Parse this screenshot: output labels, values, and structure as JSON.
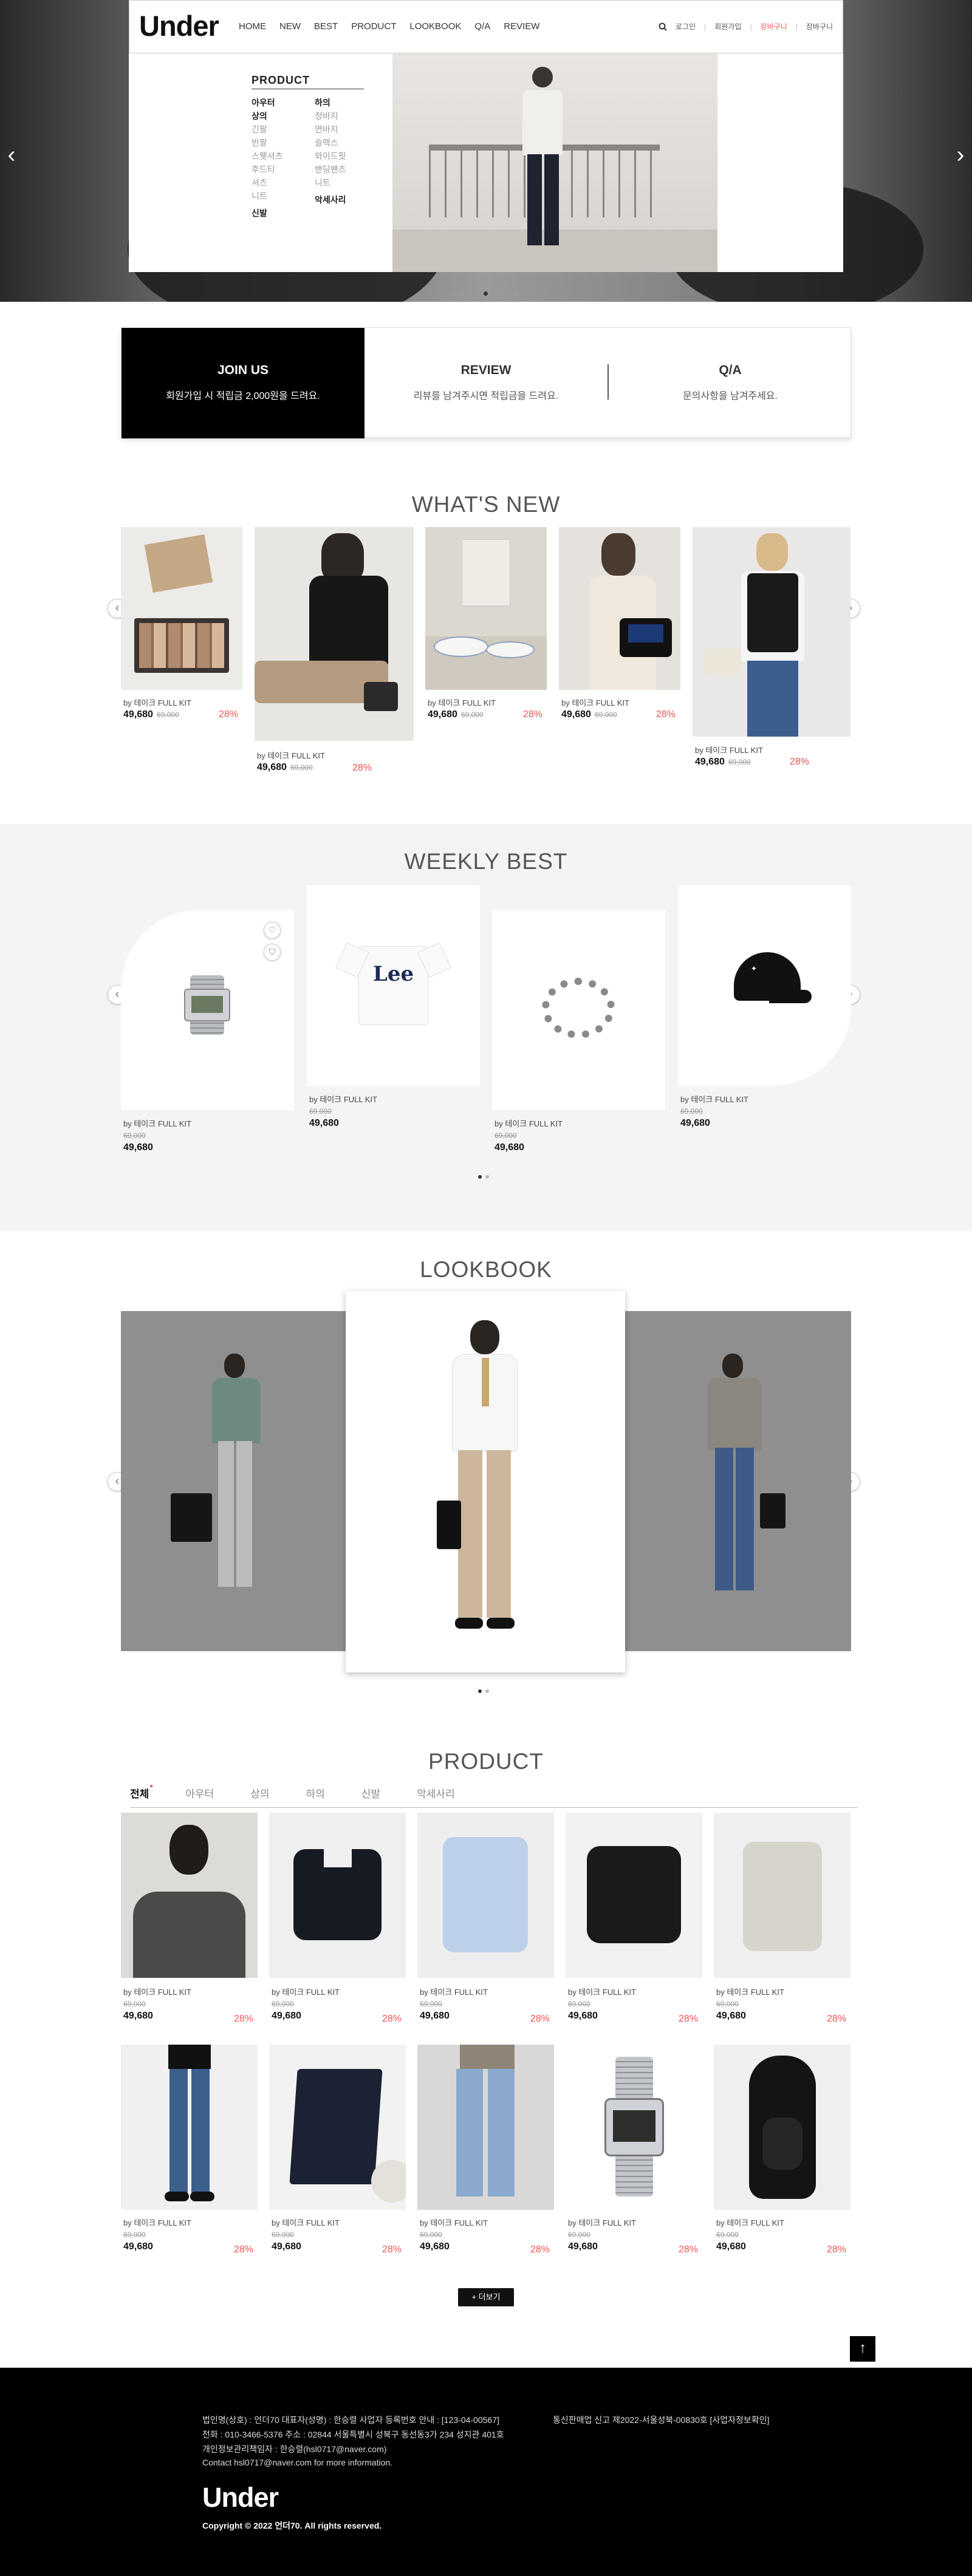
{
  "header": {
    "logo": "Under",
    "nav": [
      "HOME",
      "NEW",
      "BEST",
      "PRODUCT",
      "LOOKBOOK",
      "Q/A",
      "REVIEW"
    ],
    "util": {
      "login": "로그인",
      "join": "회원가입",
      "mypage": "장바구니",
      "cart": "장바구니"
    }
  },
  "dropdown": {
    "title": "PRODUCT",
    "col1": {
      "heads": [
        "아우터",
        "상의",
        "신발"
      ],
      "items": [
        "긴팔",
        "반팔",
        "스웻셔츠",
        "후드티",
        "셔츠",
        "니트"
      ]
    },
    "col2": {
      "heads": [
        "하의",
        "악세사리"
      ],
      "items": [
        "청바지",
        "면바지",
        "슬랙스",
        "와이드핏",
        "밴딩팬츠",
        "니트"
      ]
    }
  },
  "hero": {
    "slide_count": 9,
    "active_slide": 5
  },
  "joinbar": {
    "join_title": "JOIN US",
    "join_sub": "회원가입 시 적립금 2,000원을 드려요.",
    "review_title": "REVIEW",
    "review_sub": "리뷰를 남겨주시면 적립금을 드려요.",
    "qa_title": "Q/A",
    "qa_sub": "문의사항을 남겨주세요."
  },
  "whats_new": {
    "title": "WHAT'S NEW",
    "items": [
      {
        "name": "by 테이크 FULL KIT",
        "price": "49,680",
        "orig": "69,000",
        "disc": "28%"
      },
      {
        "name": "by 테이크 FULL KIT",
        "price": "49,680",
        "orig": "69,000",
        "disc": "28%"
      },
      {
        "name": "by 테이크 FULL KIT",
        "price": "49,680",
        "orig": "69,000",
        "disc": "28%"
      },
      {
        "name": "by 테이크 FULL KIT",
        "price": "49,680",
        "orig": "69,000",
        "disc": "28%"
      },
      {
        "name": "by 테이크 FULL KIT",
        "price": "49,680",
        "orig": "69,000",
        "disc": "28%"
      }
    ]
  },
  "weekly_best": {
    "title": "WEEKLY BEST",
    "items": [
      {
        "name": "by 테이크 FULL KIT",
        "orig": "69,000",
        "price": "49,680",
        "img": "digital-watch"
      },
      {
        "name": "by 테이크 FULL KIT",
        "orig": "69,000",
        "price": "49,680",
        "img": "lee-tshirt",
        "logo": "Lee"
      },
      {
        "name": "by 테이크 FULL KIT",
        "orig": "69,000",
        "price": "49,680",
        "img": "chain-bracelet"
      },
      {
        "name": "by 테이크 FULL KIT",
        "orig": "69,000",
        "price": "49,680",
        "img": "black-cap"
      }
    ]
  },
  "lookbook": {
    "title": "LOOKBOOK"
  },
  "product": {
    "title": "PRODUCT",
    "tabs": [
      "전체",
      "아우터",
      "상의",
      "하의",
      "신발",
      "악세사리"
    ],
    "items": [
      {
        "name": "by 테이크 FULL KIT",
        "orig": "69,000",
        "price": "49,680",
        "disc": "28%"
      },
      {
        "name": "by 테이크 FULL KIT",
        "orig": "69,000",
        "price": "49,680",
        "disc": "28%"
      },
      {
        "name": "by 테이크 FULL KIT",
        "orig": "69,000",
        "price": "49,680",
        "disc": "28%"
      },
      {
        "name": "by 테이크 FULL KIT",
        "orig": "69,000",
        "price": "49,680",
        "disc": "28%"
      },
      {
        "name": "by 테이크 FULL KIT",
        "orig": "69,000",
        "price": "49,680",
        "disc": "28%"
      },
      {
        "name": "by 테이크 FULL KIT",
        "orig": "69,000",
        "price": "49,680",
        "disc": "28%"
      },
      {
        "name": "by 테이크 FULL KIT",
        "orig": "69,000",
        "price": "49,680",
        "disc": "28%"
      },
      {
        "name": "by 테이크 FULL KIT",
        "orig": "69,000",
        "price": "49,680",
        "disc": "28%"
      },
      {
        "name": "by 테이크 FULL KIT",
        "orig": "69,000",
        "price": "49,680",
        "disc": "28%"
      },
      {
        "name": "by 테이크 FULL KIT",
        "orig": "69,000",
        "price": "49,680",
        "disc": "28%"
      }
    ],
    "more": "+ 더보기"
  },
  "footer": {
    "line1a": "법인명(상호) : 언더70    대표자(성명) : 한승렬    사업자 등록번호 안내 : [123-04-00567]",
    "line1b": "통신판매업 신고 제2022-서울성북-00830호 [사업자정보확인]",
    "line2": "전화 : 010-3466-5376    주소 : 02844 서울특별시 성북구 동선동3가 234 성지관 401호",
    "line3": "개인정보관리책임자 : 한승렬(hsl0717@naver.com)",
    "line4": "Contact hsl0717@naver.com for more information.",
    "logo": "Under",
    "copyright": "Copyright © 2022 언더70. All rights reserved."
  },
  "colors": {
    "accent": "#e55555",
    "dark": "#000000",
    "section_bg": "#f4f4f4"
  }
}
